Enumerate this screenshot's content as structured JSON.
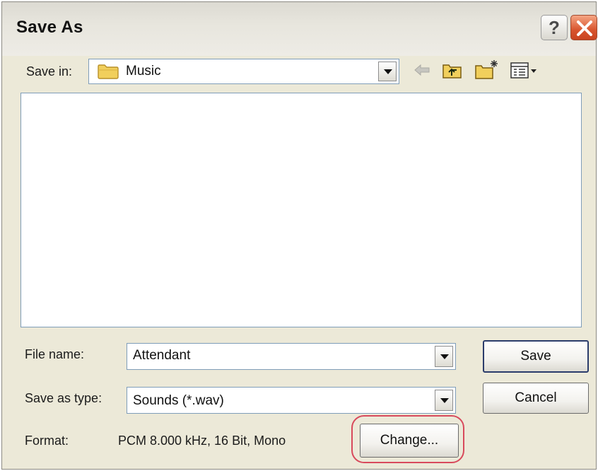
{
  "window": {
    "title": "Save As",
    "help_symbol": "?"
  },
  "toolbar": {
    "save_in_label": "Save in:",
    "location": "Music",
    "icons": [
      "folder-icon",
      "back-arrow-icon",
      "up-folder-icon",
      "new-folder-icon",
      "view-menu-icon"
    ]
  },
  "form": {
    "file_name_label": "File name:",
    "file_name_value": "Attendant",
    "save_as_type_label": "Save as type:",
    "save_as_type_value": "Sounds (*.wav)",
    "format_label": "Format:",
    "format_value": "PCM 8.000 kHz, 16 Bit, Mono"
  },
  "buttons": {
    "save": "Save",
    "cancel": "Cancel",
    "change": "Change..."
  },
  "colors": {
    "highlight": "#d84a5c",
    "field_border": "#7f9db9",
    "dialog_bg": "#ece9d8"
  }
}
